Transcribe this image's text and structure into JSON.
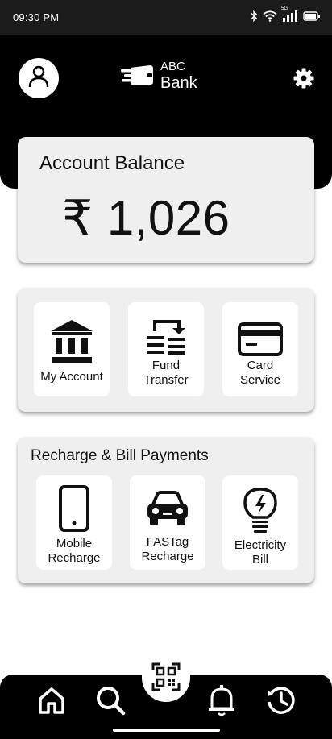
{
  "status_bar": {
    "time": "09:30 PM",
    "icons": [
      "bluetooth-icon",
      "wifi-icon",
      "5g-signal-icon",
      "battery-icon"
    ],
    "network_label": "5G"
  },
  "header": {
    "bank_name_line1": "ABC",
    "bank_name_line2": "Bank",
    "profile_icon": "user-icon",
    "settings_icon": "gear-icon"
  },
  "balance": {
    "label": "Account Balance",
    "amount": "₹ 1,026"
  },
  "services": [
    {
      "label_line1": "My Account",
      "label_line2": "",
      "icon": "bank-building-icon"
    },
    {
      "label_line1": "Fund",
      "label_line2": "Transfer",
      "icon": "fund-transfer-icon"
    },
    {
      "label_line1": "Card",
      "label_line2": "Service",
      "icon": "credit-card-icon"
    }
  ],
  "bills": {
    "title": "Recharge & Bill Payments",
    "items": [
      {
        "label_line1": "Mobile",
        "label_line2": "Recharge",
        "icon": "mobile-phone-icon"
      },
      {
        "label_line1": "FASTag",
        "label_line2": "Recharge",
        "icon": "car-icon"
      },
      {
        "label_line1": "Electricity",
        "label_line2": "Bill",
        "icon": "lightbulb-icon"
      }
    ]
  },
  "bottom_nav": {
    "items": [
      "home-icon",
      "search-icon",
      "qr-scan-icon",
      "bell-icon",
      "history-icon"
    ]
  },
  "colors": {
    "header_bg": "#000000",
    "card_bg": "#efefef",
    "tile_bg": "#ffffff",
    "text": "#111111"
  }
}
